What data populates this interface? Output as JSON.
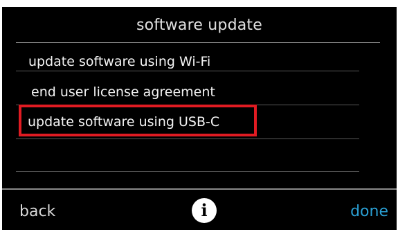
{
  "screen": {
    "title": "software update"
  },
  "menu": {
    "items": [
      {
        "label": "update software using  Wi-Fi"
      },
      {
        "label": "end user license agreement"
      },
      {
        "label": "update software using USB-C"
      }
    ],
    "highlighted_index": 2
  },
  "footer": {
    "back_label": "back",
    "info_glyph": "i",
    "info_icon": "info-icon",
    "done_label": "done"
  },
  "colors": {
    "background": "#000000",
    "text": "#f4f4f4",
    "highlight": "#e01b22",
    "done_accent": "#2a9fd3"
  }
}
